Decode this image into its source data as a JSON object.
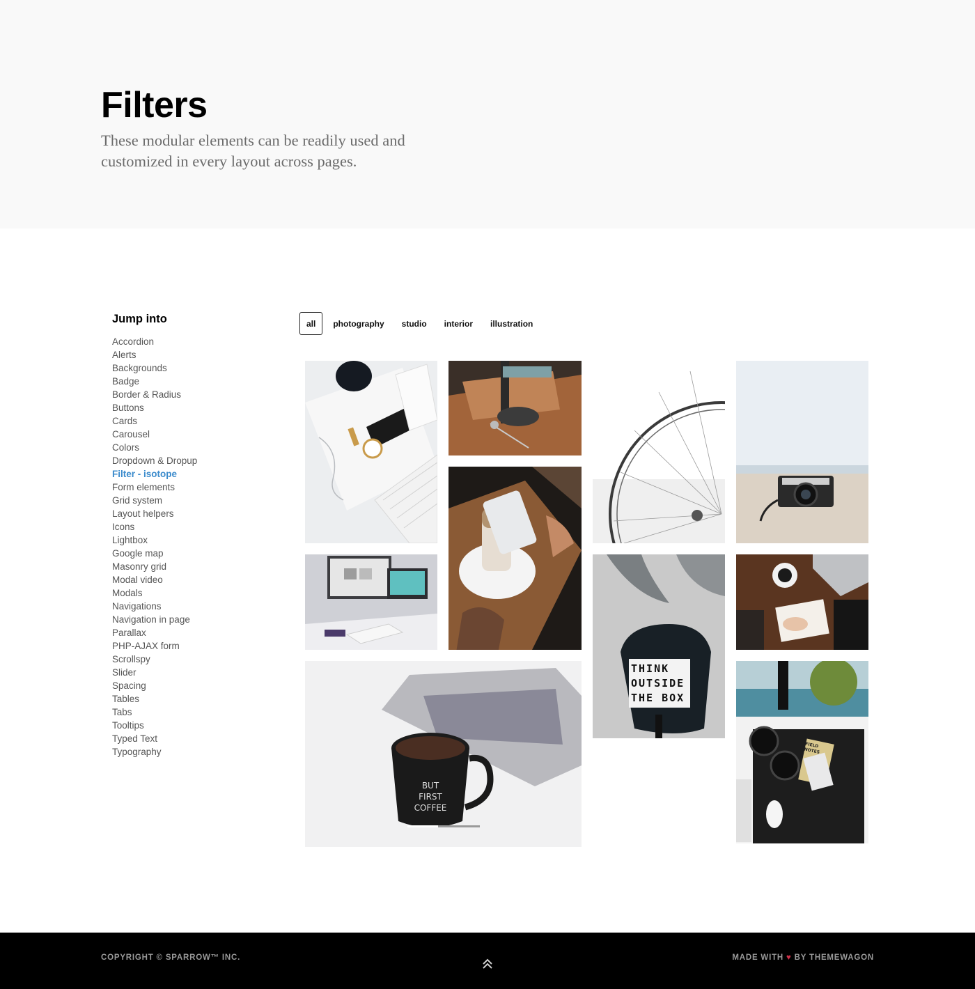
{
  "hero": {
    "title": "Filters",
    "subtitle": "These modular elements can be readily used and customized in every layout across pages."
  },
  "sidebar": {
    "heading": "Jump into",
    "items": [
      {
        "label": "Accordion"
      },
      {
        "label": "Alerts"
      },
      {
        "label": "Backgrounds"
      },
      {
        "label": "Badge"
      },
      {
        "label": "Border & Radius"
      },
      {
        "label": "Buttons"
      },
      {
        "label": "Cards"
      },
      {
        "label": "Carousel"
      },
      {
        "label": "Colors"
      },
      {
        "label": "Dropdown & Dropup"
      },
      {
        "label": "Filter - isotope",
        "active": true
      },
      {
        "label": "Form elements"
      },
      {
        "label": "Grid system"
      },
      {
        "label": "Layout helpers"
      },
      {
        "label": "Icons"
      },
      {
        "label": "Lightbox"
      },
      {
        "label": "Google map"
      },
      {
        "label": "Masonry grid"
      },
      {
        "label": "Modal video"
      },
      {
        "label": "Modals"
      },
      {
        "label": "Navigations"
      },
      {
        "label": "Navigation in page"
      },
      {
        "label": "Parallax"
      },
      {
        "label": "PHP-AJAX form"
      },
      {
        "label": "Scrollspy"
      },
      {
        "label": "Slider"
      },
      {
        "label": "Spacing"
      },
      {
        "label": "Tables"
      },
      {
        "label": "Tabs"
      },
      {
        "label": "Tooltips"
      },
      {
        "label": "Typed Text"
      },
      {
        "label": "Typography"
      }
    ]
  },
  "filters": {
    "active": "all",
    "items": [
      "all",
      "photography",
      "studio",
      "interior",
      "illustration"
    ]
  },
  "gallery": {
    "photos": [
      {
        "name": "photo-watch-keyboard"
      },
      {
        "name": "photo-leather-desk-tools"
      },
      {
        "name": "photo-ferris-wheel"
      },
      {
        "name": "photo-camera-beach"
      },
      {
        "name": "photo-coffee-phone"
      },
      {
        "name": "photo-imac-workspace"
      },
      {
        "name": "photo-think-outside-the-box",
        "caption_lines": [
          "THINK",
          "OUTSIDE",
          "THE BOX"
        ]
      },
      {
        "name": "photo-notebook-desk"
      },
      {
        "name": "photo-coffee-mug-laptop",
        "caption_lines": [
          "BUT",
          "FIRST",
          "COFFEE"
        ]
      },
      {
        "name": "photo-headphones-desk",
        "caption_lines": [
          "FIELD",
          "NOTES"
        ]
      }
    ]
  },
  "footer": {
    "copyright": "COPYRIGHT © SPARROW™ INC.",
    "made_with_prefix": "MADE WITH",
    "heart": "♥",
    "made_with_suffix": "BY THEMEWAGON",
    "back_to_top_icon": "double-chevron-up-icon"
  },
  "colors": {
    "accent": "#3b8bcc",
    "hero_bg": "#f9f9f9",
    "footer_bg": "#000000",
    "heart": "#d0314a"
  }
}
